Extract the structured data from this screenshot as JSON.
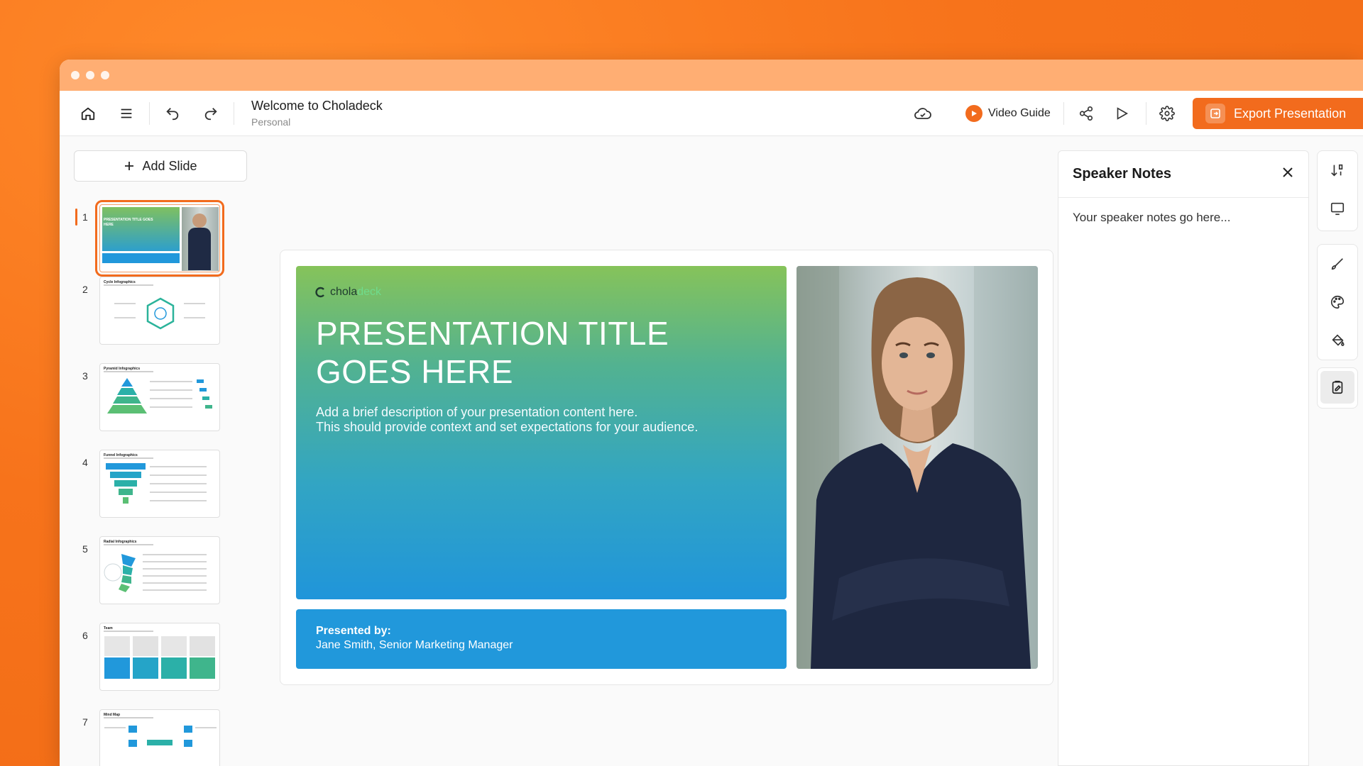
{
  "window": {
    "controls": [
      "close",
      "minimize",
      "maximize"
    ]
  },
  "toolbar": {
    "doc_title": "Welcome to Choladeck",
    "doc_workspace": "Personal",
    "video_guide_label": "Video Guide",
    "export_label": "Export Presentation"
  },
  "sidebar": {
    "add_slide_label": "Add Slide",
    "slides": [
      {
        "number": "1",
        "title": "PRESENTATION TITLE GOES HERE",
        "active": true
      },
      {
        "number": "2",
        "title": "Cycle Infographics"
      },
      {
        "number": "3",
        "title": "Pyramid Infographics"
      },
      {
        "number": "4",
        "title": "Funnel Infographics"
      },
      {
        "number": "5",
        "title": "Radial Infographics"
      },
      {
        "number": "6",
        "title": "Team"
      },
      {
        "number": "7",
        "title": "Mind Map"
      }
    ]
  },
  "slide": {
    "logo_part1": "chola",
    "logo_part2": "deck",
    "title": "PRESENTATION TITLE GOES HERE",
    "description": "Add a brief description of your presentation content here.\nThis should provide context and set expectations for your audience.",
    "presented_by_label": "Presented by:",
    "presenter": "Jane Smith, Senior Marketing Manager"
  },
  "notes": {
    "title": "Speaker Notes",
    "body": "Your speaker notes go here..."
  },
  "colors": {
    "accent": "#f26b1d",
    "slide_blue": "#2198db",
    "slide_green": "#86c35a"
  }
}
